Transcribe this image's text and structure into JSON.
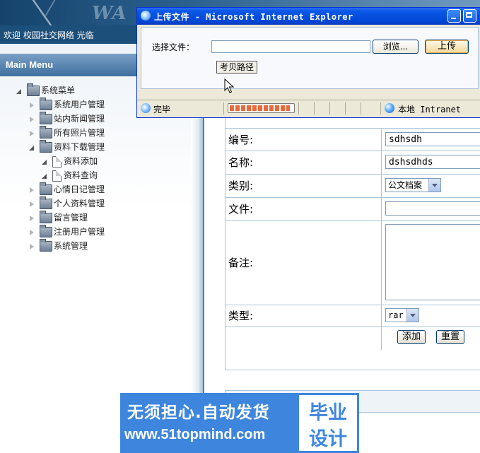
{
  "banner": {
    "logo_text": "WA"
  },
  "header": {
    "welcome": "欢迎 校园社交网络 光临"
  },
  "menu": {
    "title": "Main Menu",
    "root": "系统菜单",
    "items": [
      {
        "label": "系统用户管理",
        "expanded": false
      },
      {
        "label": "站内新闻管理",
        "expanded": false
      },
      {
        "label": "所有照片管理",
        "expanded": false
      },
      {
        "label": "资料下载管理",
        "expanded": true,
        "children": [
          "资料添加",
          "资料查询"
        ]
      },
      {
        "label": "心情日记管理",
        "expanded": false
      },
      {
        "label": "个人资料管理",
        "expanded": false
      },
      {
        "label": "留言管理",
        "expanded": false
      },
      {
        "label": "注册用户管理",
        "expanded": false
      },
      {
        "label": "系统管理",
        "expanded": false
      }
    ]
  },
  "form": {
    "fields": [
      {
        "label": "编号:",
        "value": "sdhsdh"
      },
      {
        "label": "名称:",
        "value": "dshsdhds"
      },
      {
        "label": "类别:",
        "value": "公文档案"
      },
      {
        "label": "文件:",
        "value": ""
      },
      {
        "label": "备注:",
        "value": ""
      },
      {
        "label": "类型:",
        "value": "rar"
      }
    ],
    "add_button": "添加",
    "reset_button": "重置"
  },
  "popup": {
    "title": "上传文件 - Microsoft Internet Explorer",
    "file_label": "选择文件：",
    "file_value": "",
    "browse_button": "浏览...",
    "upload_button": "上传",
    "copy_path_button": "考贝路径",
    "status_text": "完毕",
    "progress": 0.95,
    "zone_text": "本地 Intranet"
  },
  "ad": {
    "line1": "无须担心.自动发货",
    "line2": "www.51topmind.com",
    "box_line1": "毕业",
    "box_line2": "设计"
  },
  "colors": {
    "title_bar": "#0a58e6",
    "menu_header": "#3e6f9e",
    "form_border": "#a9c3d9",
    "ad_blue": "#3e86dd"
  }
}
